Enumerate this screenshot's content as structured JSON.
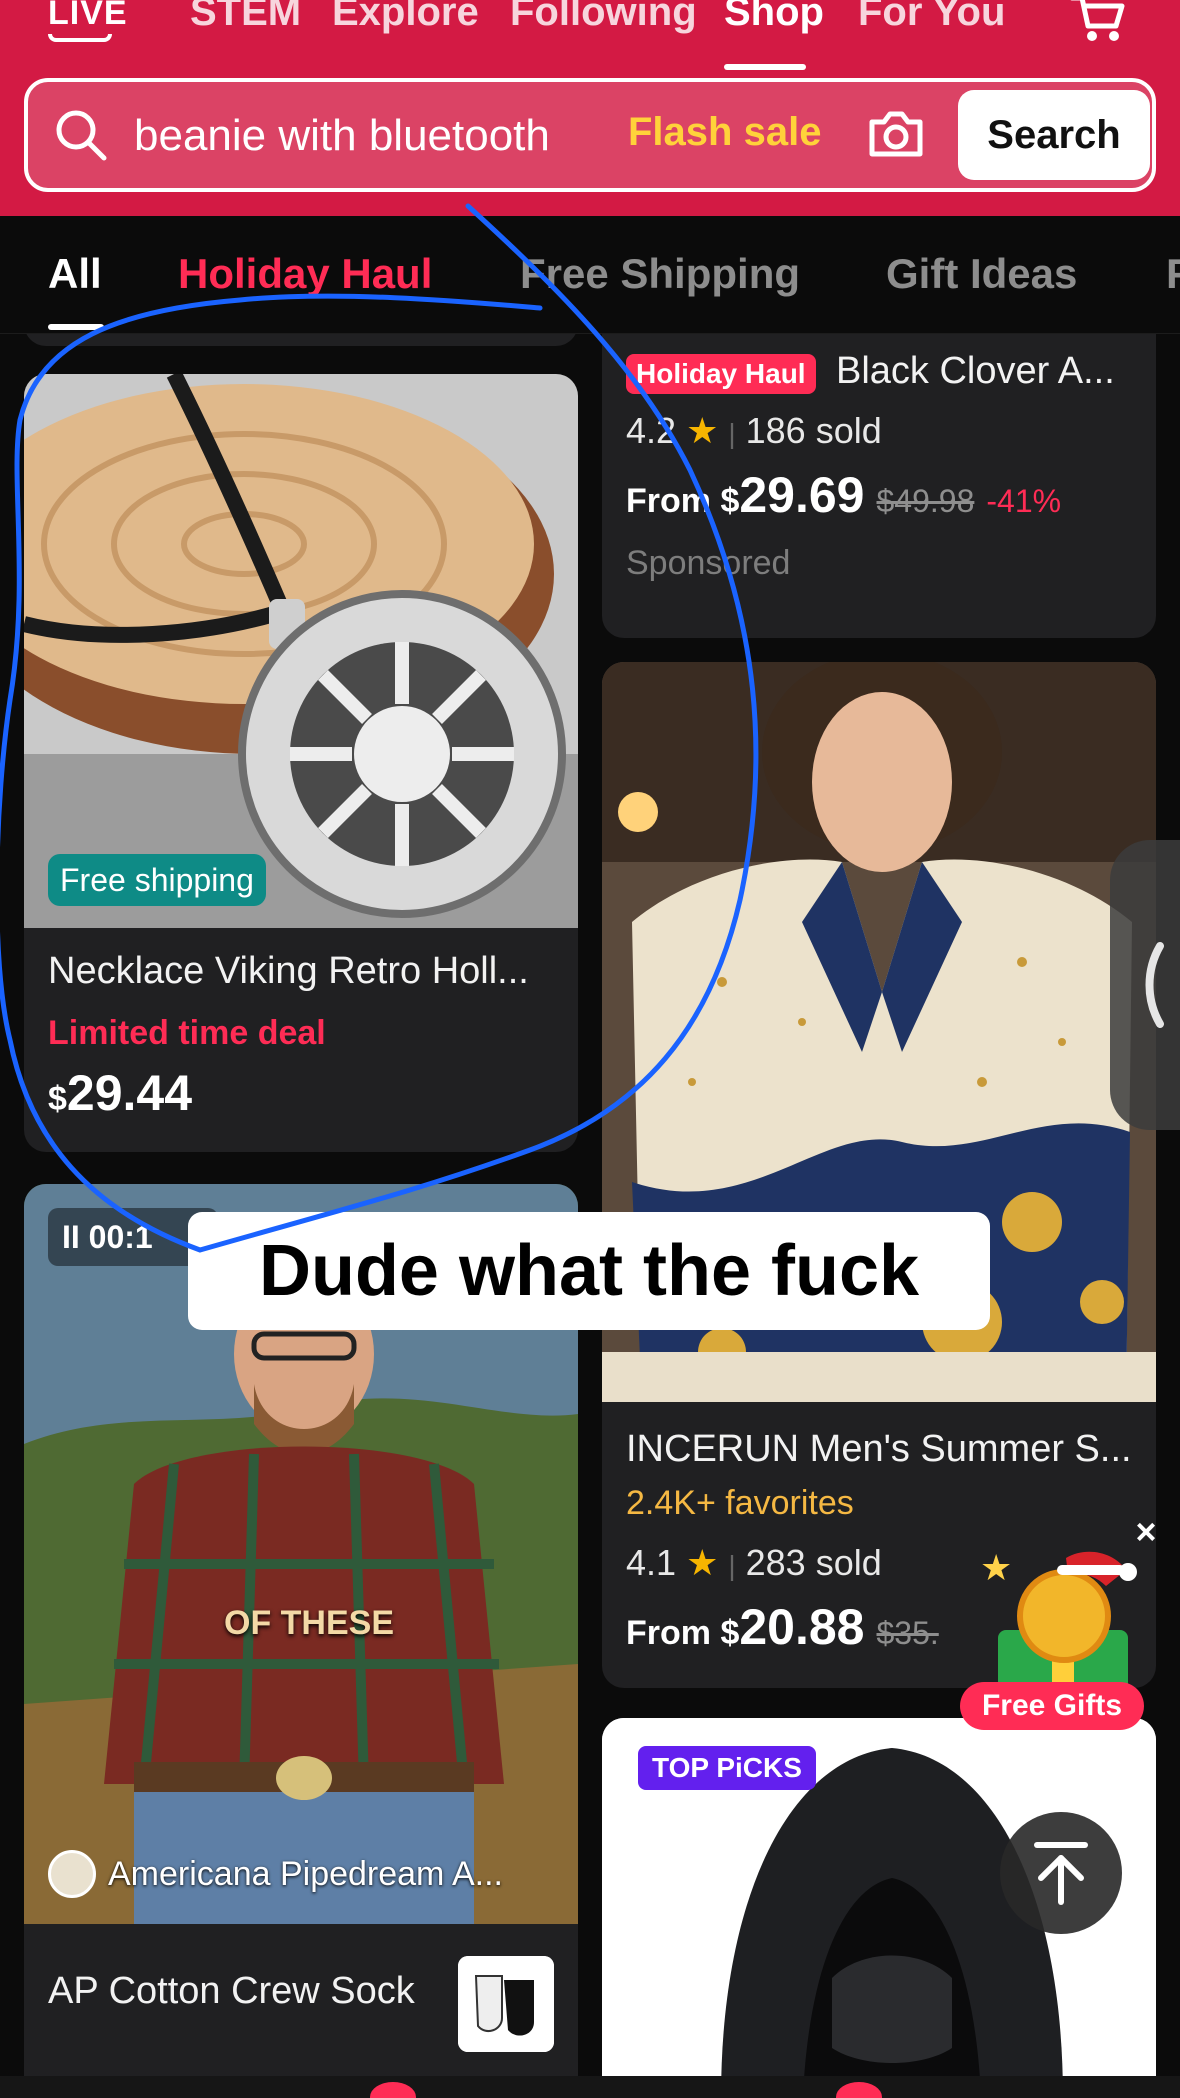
{
  "topnav": {
    "live": "LIVE",
    "tabs": [
      "STEM",
      "Explore",
      "Following",
      "Shop",
      "For You"
    ],
    "active_tab": "Shop"
  },
  "search": {
    "value": "beanie with bluetooth",
    "flash": "Flash sale",
    "button": "Search"
  },
  "categories": [
    "All",
    "Holiday Haul",
    "Free Shipping",
    "Gift Ideas",
    "F"
  ],
  "products": {
    "necklace": {
      "badge": "Free shipping",
      "title": "Necklace Viking Retro Holl...",
      "deal": "Limited time deal",
      "currency": "$",
      "price": "29.44"
    },
    "clover": {
      "badge": "Holiday Haul",
      "title": "Black Clover A...",
      "rating": "4.2",
      "sold": "186 sold",
      "from": "From $",
      "price": "29.69",
      "orig": "$49.98",
      "disc": "-41%",
      "sponsored": "Sponsored"
    },
    "shirt": {
      "title": "INCERUN Men's Summer S...",
      "favorites": "2.4K+ favorites",
      "rating": "4.1",
      "sold": "283 sold",
      "from": "From $",
      "price": "20.88",
      "orig": "$35."
    },
    "sock": {
      "pause": "II 00:1",
      "overlay": "OF THESE",
      "creator": "Americana Pipedream A...",
      "title": "AP Cotton Crew Sock"
    },
    "hoodie": {
      "badge": "TOP PiCKS"
    }
  },
  "caption": "Dude what the fuck",
  "gift": {
    "label": "Free Gifts",
    "close": "×"
  },
  "colors": {
    "brand": "#d31a44",
    "accent": "#ff2c55",
    "flash": "#ffd23a",
    "scribble": "#1a63ff"
  }
}
